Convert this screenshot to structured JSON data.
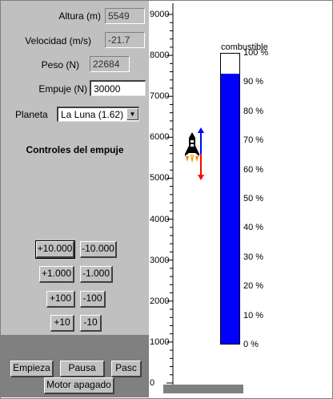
{
  "fields": {
    "altura": {
      "label": "Altura (m)",
      "value": "5549"
    },
    "velocidad": {
      "label": "Velocidad (m/s)",
      "value": "-21.7"
    },
    "peso": {
      "label": "Peso (N)",
      "value": "22684"
    },
    "empuje": {
      "label": "Empuje (N)",
      "value": "30000"
    }
  },
  "planeta": {
    "label": "Planeta",
    "selected": "La Luna (1.62)"
  },
  "controles_title": "Controles del empuje",
  "thrust_buttons": [
    {
      "plus": "+10.000",
      "minus": "-10.000"
    },
    {
      "plus": "+1.000",
      "minus": "-1.000"
    },
    {
      "plus": "+100",
      "minus": "-100"
    },
    {
      "plus": "+10",
      "minus": "-10"
    }
  ],
  "actions": {
    "start": "Empieza",
    "pause": "Pausa",
    "step": "Pasc",
    "motor": "Motor apagado"
  },
  "altitude_axis": {
    "labels": [
      "9000",
      "8000",
      "7000",
      "6000",
      "5000",
      "4000",
      "3000",
      "2000",
      "1000",
      "0"
    ],
    "values": [
      9000,
      8000,
      7000,
      6000,
      5000,
      4000,
      3000,
      2000,
      1000,
      0
    ],
    "rocket_altitude": 5549
  },
  "fuel_gauge": {
    "title": "combustible",
    "labels": [
      "100 %",
      "90 %",
      "80 %",
      "70 %",
      "60 %",
      "50 %",
      "40 %",
      "30 %",
      "20 %",
      "10 %",
      "0 %"
    ],
    "level_percent": 93,
    "fill_color": "#0000ff"
  },
  "colors": {
    "panel": "#c0c0c0",
    "dark_panel": "#808080",
    "thrust_arrow": "#0000ff",
    "weight_arrow": "#ff0000"
  },
  "icons": {
    "rocket": "rocket-icon",
    "dropdown": "chevron-down-icon"
  }
}
